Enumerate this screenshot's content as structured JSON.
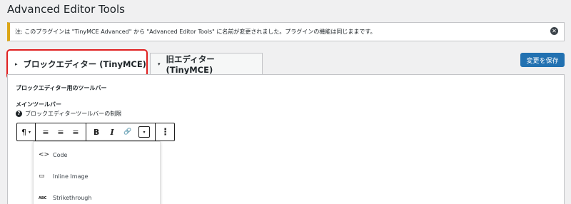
{
  "page": {
    "title": "Advanced Editor Tools"
  },
  "notice": {
    "text": "注: このプラグインは \"TinyMCE Advanced\" から \"Advanced Editor Tools\" に名前が変更されました。プラグインの機能は同じままです。",
    "dismiss_icon": "close-circle-icon"
  },
  "tabs": [
    {
      "label": "ブロックエディター (TinyMCE)",
      "active": true,
      "arrow": "▸"
    },
    {
      "label": "旧エディター (TinyMCE)",
      "active": false,
      "arrow": "▾"
    }
  ],
  "save_button": {
    "label": "変更を保存"
  },
  "panel": {
    "section_title": "ブロックエディター用のツールバー",
    "main_toolbar_title": "メインツールバー",
    "help_text": "ブロックエディターツールバーの制限"
  },
  "toolbar": {
    "paragraph": "¶",
    "paragraph_arrow": "▾",
    "align_left": "≡",
    "align_center": "≡",
    "align_right": "≡",
    "bold": "B",
    "italic": "I",
    "link": "🔗",
    "more_arrow": "▾",
    "options": "⋮"
  },
  "dropdown": {
    "items": [
      {
        "label": "Code",
        "icon": "<>"
      },
      {
        "label": "Inline Image",
        "icon": "▭"
      },
      {
        "label": "Strikethrough",
        "icon": "ABC"
      }
    ]
  },
  "colors": {
    "accent": "#2271b1",
    "notice_border": "#dba617",
    "highlight": "#e02020"
  }
}
